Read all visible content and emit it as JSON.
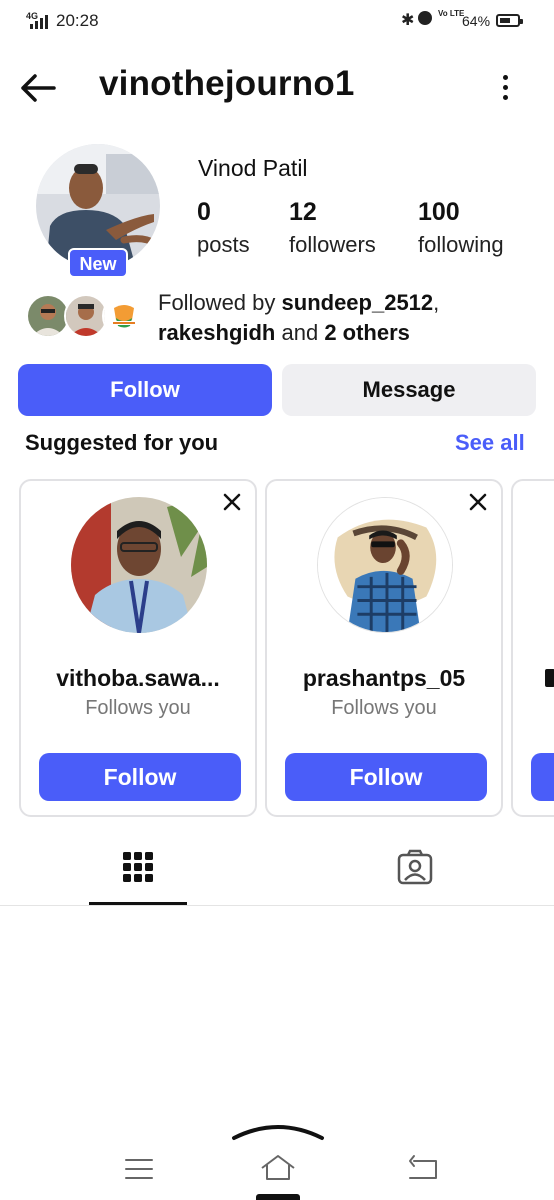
{
  "status_bar": {
    "network": "4G",
    "time": "20:28",
    "volte": "Vo LTE",
    "battery_pct": "64%",
    "battery_level": 0.64
  },
  "header": {
    "username": "vinothejourno1",
    "back_icon": "arrow-left-icon",
    "more_icon": "more-vertical-icon"
  },
  "profile": {
    "full_name": "Vinod Patil",
    "badge": "New",
    "stats": [
      {
        "value": "0",
        "label": "posts"
      },
      {
        "value": "12",
        "label": "followers"
      },
      {
        "value": "100",
        "label": "following"
      }
    ],
    "followed_by": {
      "prefix": "Followed by ",
      "user1": "sundeep_2512",
      "separator": ",",
      "user2": "rakeshgidh",
      "connector": " and ",
      "others": "2 others"
    }
  },
  "actions": {
    "follow_label": "Follow",
    "message_label": "Message"
  },
  "suggested": {
    "title": "Suggested for you",
    "see_all": "See all",
    "cards": [
      {
        "username": "vithoba.sawa...",
        "subtitle": "Follows you",
        "button": "Follow"
      },
      {
        "username": "prashantps_05",
        "subtitle": "Follows you",
        "button": "Follow"
      }
    ]
  },
  "tabs": {
    "active": "posts-grid",
    "items": [
      "grid-icon",
      "tagged-icon"
    ]
  },
  "colors": {
    "accent": "#4a5df9",
    "secondary_button": "#efeff2"
  }
}
